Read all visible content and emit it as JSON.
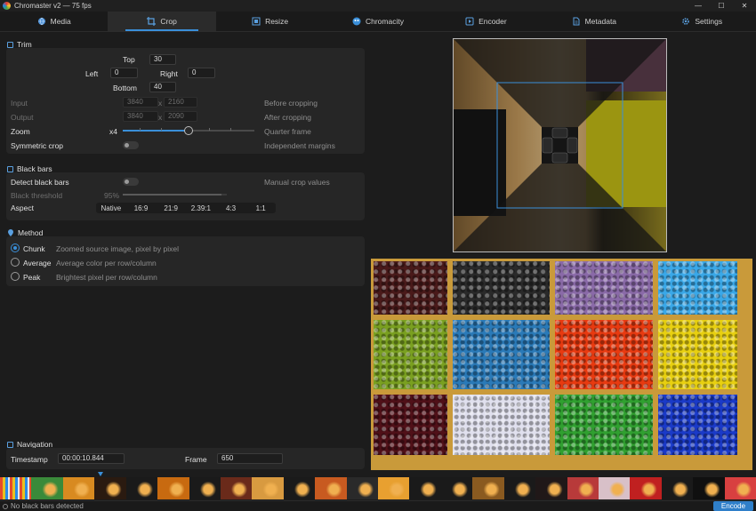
{
  "window": {
    "title": "Chromaster v2 — 75 fps"
  },
  "tabs": [
    {
      "label": "Media",
      "icon": "globe-icon"
    },
    {
      "label": "Crop",
      "icon": "crop-icon",
      "active": true
    },
    {
      "label": "Resize",
      "icon": "resize-icon"
    },
    {
      "label": "Chromacity",
      "icon": "color-palette-icon"
    },
    {
      "label": "Encoder",
      "icon": "encoder-icon"
    },
    {
      "label": "Metadata",
      "icon": "document-icon"
    },
    {
      "label": "Settings",
      "icon": "gear-icon"
    }
  ],
  "trim": {
    "title": "Trim",
    "top_label": "Top",
    "top_value": "30",
    "left_label": "Left",
    "left_value": "0",
    "right_label": "Right",
    "right_value": "0",
    "bottom_label": "Bottom",
    "bottom_value": "40",
    "input_label": "Input",
    "input_w": "3840",
    "input_h": "2160",
    "input_hint": "Before cropping",
    "output_label": "Output",
    "output_w": "3840",
    "output_h": "2090",
    "output_hint": "After cropping",
    "times": "x",
    "zoom_label": "Zoom",
    "zoom_value": "x4",
    "zoom_fraction": 0.5,
    "zoom_hint": "Quarter frame",
    "symmetric_label": "Symmetric crop",
    "symmetric_on": false,
    "symmetric_hint": "Independent margins"
  },
  "black_bars": {
    "title": "Black bars",
    "detect_label": "Detect black bars",
    "detect_on": false,
    "detect_hint": "Manual crop values",
    "threshold_label": "Black threshold",
    "threshold_value": "95%",
    "threshold_fraction": 0.95,
    "aspect_label": "Aspect",
    "aspect_options": [
      "Native",
      "16:9",
      "21:9",
      "2.39:1",
      "4:3",
      "1:1"
    ]
  },
  "method": {
    "title": "Method",
    "options": [
      {
        "label": "Chunk",
        "desc": "Zoomed source image, pixel by pixel",
        "selected": true
      },
      {
        "label": "Average",
        "desc": "Average color per row/column",
        "selected": false
      },
      {
        "label": "Peak",
        "desc": "Brightest pixel per row/column",
        "selected": false
      }
    ]
  },
  "navigation": {
    "title": "Navigation",
    "timestamp_label": "Timestamp",
    "timestamp_value": "00:00:10.844",
    "frame_label": "Frame",
    "frame_value": "650"
  },
  "status": {
    "text": "No black bars detected",
    "encode_label": "Encode"
  },
  "colors": {
    "accent": "#3a8fd9",
    "panel": "#262626",
    "background": "#1c1c1c"
  }
}
